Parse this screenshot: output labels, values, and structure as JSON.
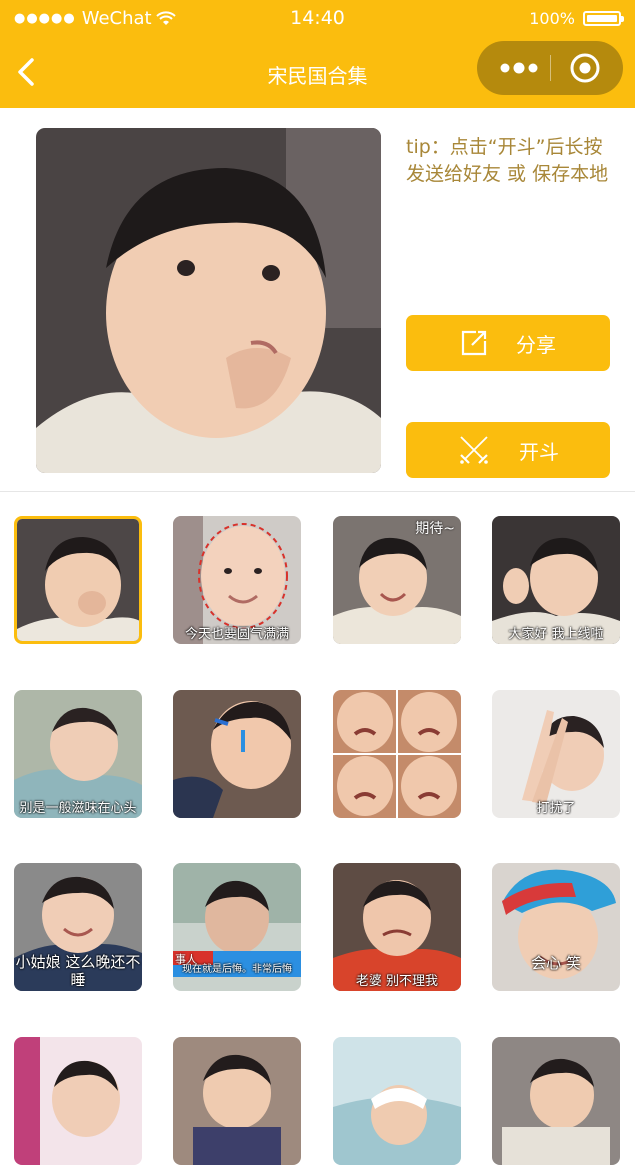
{
  "status": {
    "carrier": "WeChat",
    "time": "14:40",
    "battery": "100%"
  },
  "nav": {
    "title": "宋民国合集"
  },
  "tip": "tip：点击“开斗”后长按发送给好友 或 保存本地",
  "buttons": {
    "share": "分享",
    "fight": "开斗"
  },
  "grid": [
    {
      "caption": "",
      "top": ""
    },
    {
      "caption": "今天也要圆气满满",
      "top": ""
    },
    {
      "caption": "",
      "top": "期待~"
    },
    {
      "caption": "大家好 我上线啦",
      "top": ""
    },
    {
      "caption": "别是一般滋味在心头",
      "top": ""
    },
    {
      "caption": "",
      "top": ""
    },
    {
      "caption": "",
      "top": ""
    },
    {
      "caption": "打扰了",
      "top": ""
    },
    {
      "caption": "小姑娘 这么晚还不睡",
      "top": ""
    },
    {
      "caption": "现在就是后悔。非常后悔",
      "top": "事人"
    },
    {
      "caption": "老婆 别不理我",
      "top": ""
    },
    {
      "caption": "会心  笑",
      "top": ""
    },
    {
      "caption": "",
      "top": ""
    },
    {
      "caption": "",
      "top": ""
    },
    {
      "caption": "",
      "top": ""
    },
    {
      "caption": "",
      "top": ""
    }
  ]
}
